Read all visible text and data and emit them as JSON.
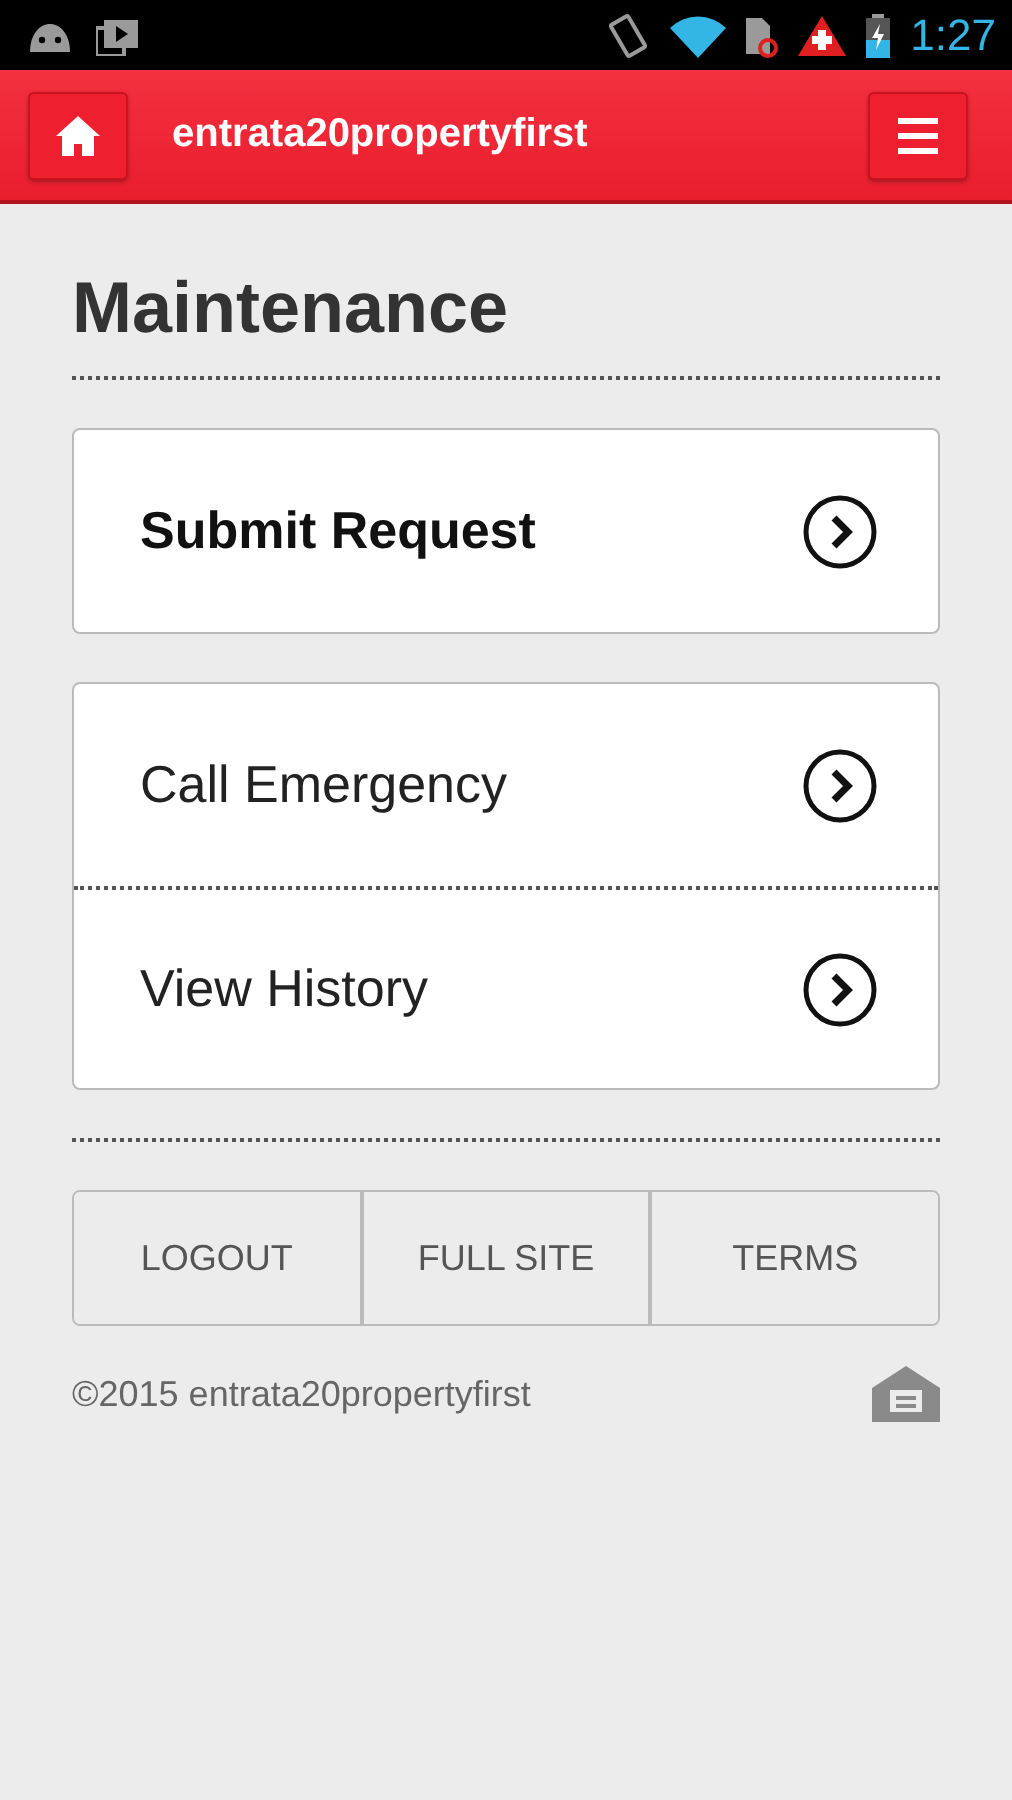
{
  "status_bar": {
    "time": "1:27"
  },
  "header": {
    "title": "entrata20propertyfirst"
  },
  "page_title": "Maintenance",
  "primary_action": {
    "label": "Submit Request"
  },
  "actions": [
    {
      "label": "Call Emergency"
    },
    {
      "label": "View History"
    }
  ],
  "footer_links": [
    "LOGOUT",
    "FULL SITE",
    "TERMS"
  ],
  "copyright": "©2015 entrata20propertyfirst"
}
